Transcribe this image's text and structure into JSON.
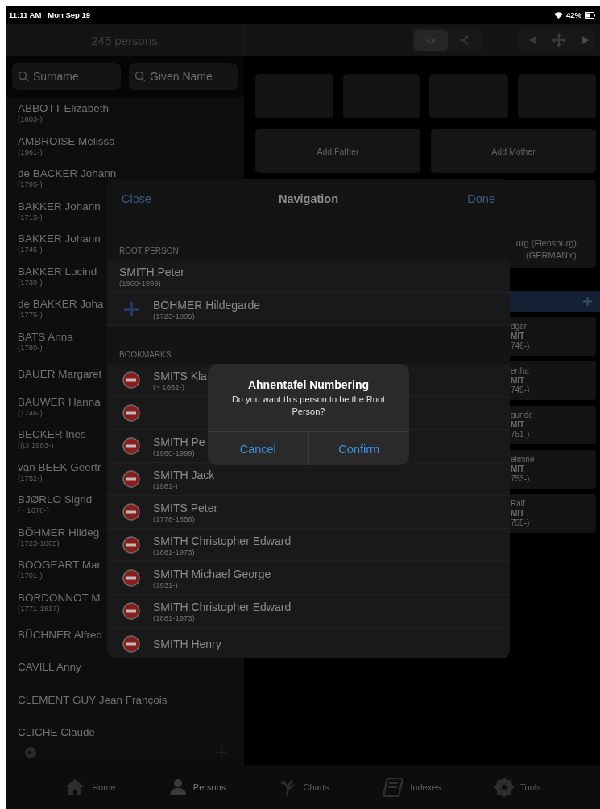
{
  "status_bar": {
    "time": "11:11 AM",
    "date": "Mon Sep 19",
    "battery": "42%"
  },
  "persons_panel": {
    "title": "245 persons",
    "search": [
      {
        "placeholder": "Surname"
      },
      {
        "placeholder": "Given Name"
      }
    ],
    "persons": [
      {
        "name": "ABBOTT Elizabeth",
        "dates": "(1803-)"
      },
      {
        "name": "AMBROISE Melissa",
        "dates": "(1961-)"
      },
      {
        "name": "de BACKER Johann",
        "dates": "(1795-)"
      },
      {
        "name": "BAKKER Johann",
        "dates": "(1715-)"
      },
      {
        "name": "BAKKER Johann",
        "dates": "(1745-)"
      },
      {
        "name": "BAKKER Lucind",
        "dates": "(1730-)"
      },
      {
        "name": "de BAKKER Joha",
        "dates": "(1775-)"
      },
      {
        "name": "BATS Anna",
        "dates": "(1780-)"
      },
      {
        "name": "BAUER Margaret"
      },
      {
        "name": "BAUWER Hanna",
        "dates": "(1746-)"
      },
      {
        "name": "BECKER Ines",
        "dates": "((c) 1983-)"
      },
      {
        "name": "van BEEK Geertr",
        "dates": "(1752-)"
      },
      {
        "name": "BJØRLO Sigrid",
        "dates": "(~ 1670-)"
      },
      {
        "name": "BÖHMER Hildeg",
        "dates": "(1723-1805)"
      },
      {
        "name": "BOOGEART Mar",
        "dates": "(1701-)"
      },
      {
        "name": "BORDONNOT M",
        "dates": "(1771-1817)"
      },
      {
        "name": "BÜCHNER Alfred"
      },
      {
        "name": "CAVILL Anny"
      },
      {
        "name": "CLEMENT GUY Jean François"
      },
      {
        "name": "CLICHE Claude"
      }
    ]
  },
  "chart_panel": {
    "view_modes": [
      {
        "selected": true
      },
      {
        "selected": false
      }
    ],
    "add_father": "Add Father",
    "add_mother": "Add Mother",
    "place": [
      "urg (Flensburg)",
      "(GERMANY)"
    ],
    "children": [
      {
        "given": "dgar",
        "surname": "MIT",
        "dates": "746-)"
      },
      {
        "given": "ertha",
        "surname": "MIT",
        "dates": "749-)"
      },
      {
        "given": "gunde",
        "surname": "MIT",
        "dates": "751-)"
      },
      {
        "given": "elmine",
        "surname": "MIT",
        "dates": "753-)"
      },
      {
        "given": "Ralf",
        "surname": "MIT",
        "dates": "755-)"
      }
    ]
  },
  "navigation_sheet": {
    "close": "Close",
    "title": "Navigation",
    "done": "Done",
    "root_heading": "ROOT PERSON",
    "root_person": {
      "name": "SMITH Peter",
      "dates": "(1960-1999)"
    },
    "candidate": {
      "name": "BÖHMER Hildegarde",
      "dates": "(1723-1805)"
    },
    "bookmarks_heading": "BOOKMARKS",
    "bookmarks": [
      {
        "deletable": true,
        "name": "SMITS Kla",
        "dates": "(~ 1662-)"
      },
      {
        "deletable": true
      },
      {
        "deletable": true,
        "name": "SMITH Pe",
        "dates": "(1960-1999)"
      },
      {
        "deletable": true,
        "name": "SMITH Jack",
        "dates": "(1981-)"
      },
      {
        "deletable": true,
        "name": "SMITS Peter",
        "dates": "(1778-1858)"
      },
      {
        "deletable": true,
        "name": "SMITH Christopher Edward",
        "dates": "(1881-1973)"
      },
      {
        "deletable": true,
        "name": "SMITH Michael George",
        "dates": "(1931-)"
      },
      {
        "deletable": true,
        "name": "SMITH Christopher Edward",
        "dates": "(1881-1973)"
      },
      {
        "deletable": true,
        "name": "SMITH Henry"
      }
    ]
  },
  "alert": {
    "title": "Ahnentafel Numbering",
    "message": "Do you want this person to be the Root Person?",
    "buttons": [
      "Cancel",
      "Confirm"
    ]
  },
  "tab_bar": [
    {
      "label": "Home",
      "selected": false
    },
    {
      "label": "Persons",
      "selected": true
    },
    {
      "label": "Charts",
      "selected": false
    },
    {
      "label": "Indexes",
      "selected": false
    },
    {
      "label": "Tools",
      "selected": false
    }
  ]
}
